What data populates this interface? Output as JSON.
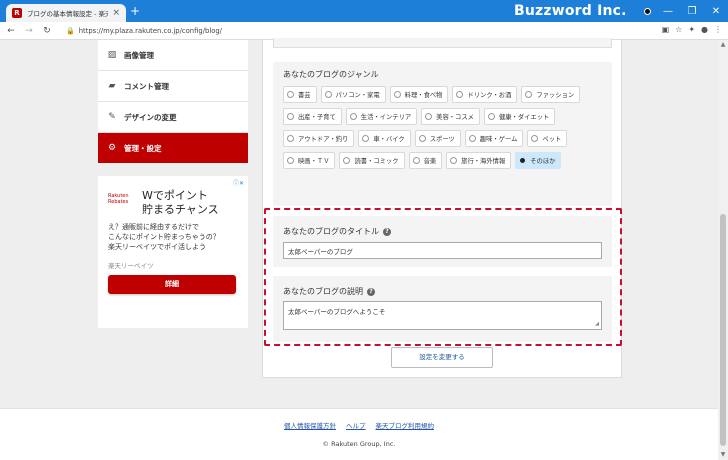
{
  "browser": {
    "tab_title": "ブログの基本情報設定 - 楽天ブログ",
    "tab_favicon": "R",
    "tab_close": "×",
    "new_tab": "+",
    "watermark": "Buzzword Inc.",
    "window_buttons": [
      "—",
      "❐",
      "✕"
    ],
    "url": "https://my.plaza.rakuten.co.jp/config/blog/"
  },
  "sidebar": {
    "items": [
      {
        "label": "画像管理",
        "icon": "image-icon"
      },
      {
        "label": "コメント管理",
        "icon": "comment-icon"
      },
      {
        "label": "デザインの変更",
        "icon": "palette-icon"
      },
      {
        "label": "管理・設定",
        "icon": "gear-icon",
        "active": true
      }
    ],
    "active_color": "#bf0000"
  },
  "ad": {
    "badge": "ⓘ✕",
    "logo_text": "Rakuten Rebates",
    "headline_line1": "Wでポイント",
    "headline_line2": "貯まるチャンス",
    "body_line1": "え？通販前に経由するだけで",
    "body_line2": "こんなにポイント貯まっちゃうの？",
    "body_line3": "楽天リーベイツでポイ活しよう",
    "sub": "楽天リーベイツ",
    "button": "詳細"
  },
  "genre": {
    "label": "あなたのブログのジャンル",
    "options": [
      {
        "label": "書芸",
        "selected": false
      },
      {
        "label": "パソコン・家電",
        "selected": false
      },
      {
        "label": "料理・食べ物",
        "selected": false
      },
      {
        "label": "ドリンク・お酒",
        "selected": false
      },
      {
        "label": "ファッション",
        "selected": false
      },
      {
        "label": "出産・子育て",
        "selected": false
      },
      {
        "label": "生活・インテリア",
        "selected": false
      },
      {
        "label": "美容・コスメ",
        "selected": false
      },
      {
        "label": "健康・ダイエット",
        "selected": false
      },
      {
        "label": "アウトドア・釣り",
        "selected": false
      },
      {
        "label": "車・バイク",
        "selected": false
      },
      {
        "label": "スポーツ",
        "selected": false
      },
      {
        "label": "趣味・ゲーム",
        "selected": false
      },
      {
        "label": "ペット",
        "selected": false
      },
      {
        "label": "映画・ＴＶ",
        "selected": false
      },
      {
        "label": "読書・コミック",
        "selected": false
      },
      {
        "label": "音楽",
        "selected": false
      },
      {
        "label": "旅行・海外情報",
        "selected": false
      },
      {
        "label": "そのほか",
        "selected": true
      }
    ]
  },
  "blog_title": {
    "label": "あなたのブログのタイトル",
    "value": "太郎ペーパーのブログ"
  },
  "blog_description": {
    "label": "あなたのブログの説明",
    "value": "太郎ペーパーのブログへようこそ"
  },
  "submit_label": "設定を変更する",
  "footer": {
    "links": [
      "個人情報保護方針",
      "ヘルプ",
      "楽天ブログ利用規約"
    ],
    "copyright": "© Rakuten Group, Inc."
  },
  "colors": {
    "highlight_frame": "#c8102e",
    "selected_option": "#cde8fb"
  }
}
